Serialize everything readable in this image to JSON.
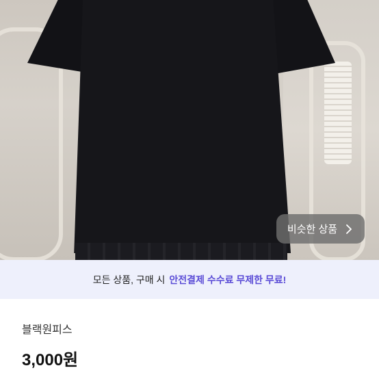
{
  "photo": {
    "similar_products_label": "비슷한 상품"
  },
  "banner": {
    "plain_text": "모든 상품, 구매 시",
    "accent_text": "안전결제 수수료 무제한 무료!",
    "accent_color": "#5a4bd6"
  },
  "product": {
    "title": "블랙원피스",
    "price": "3,000원"
  },
  "icons": {
    "similar_arrow": "chevron-right-icon"
  }
}
